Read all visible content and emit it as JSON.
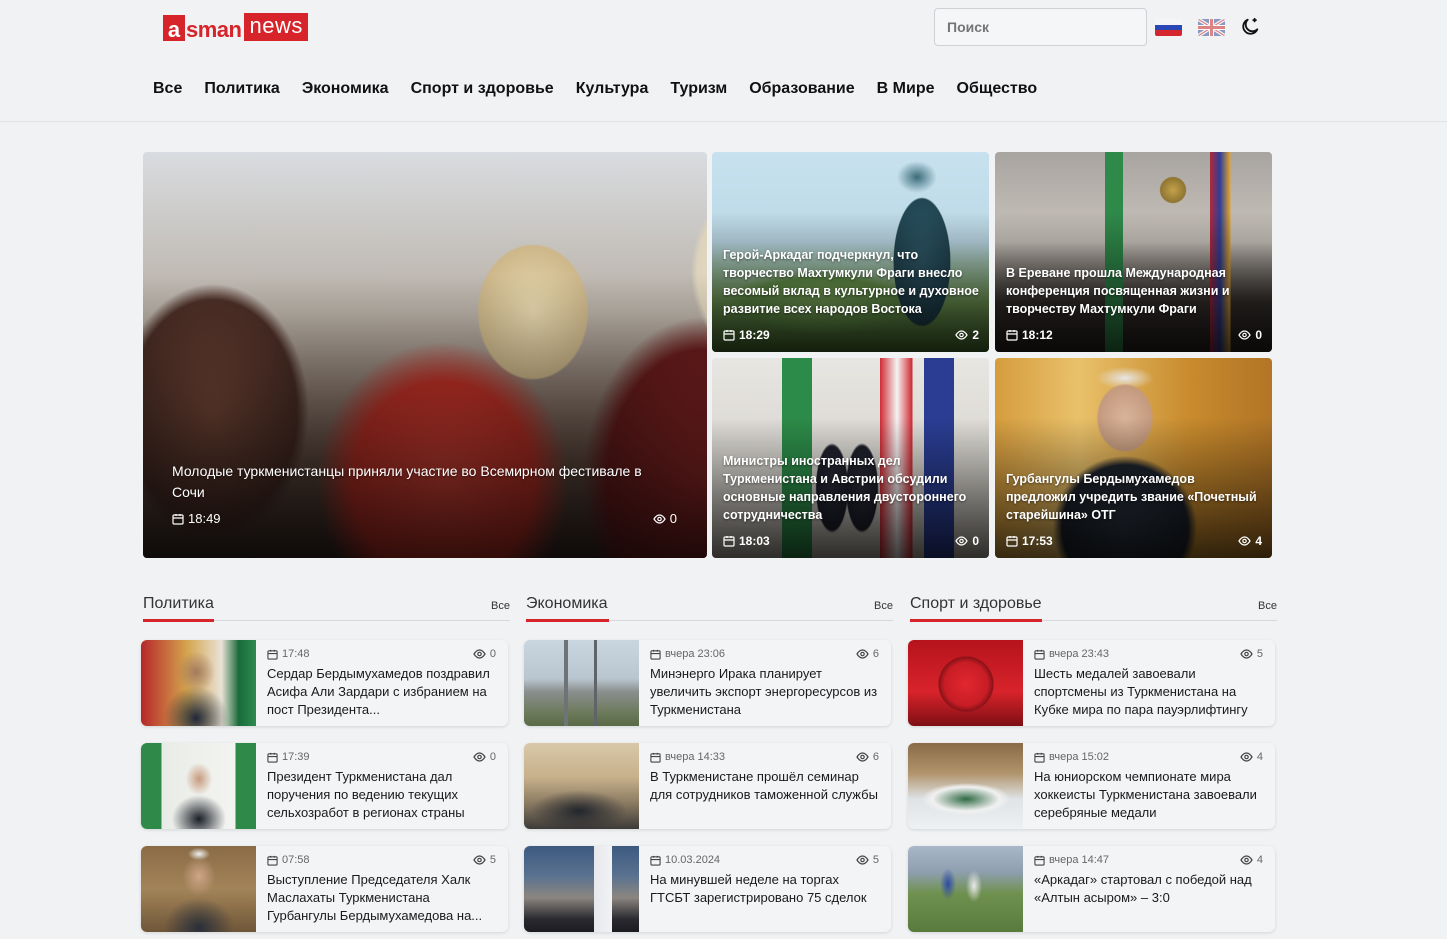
{
  "logo": {
    "a": "a",
    "sman": "sman",
    "news": "news"
  },
  "search": {
    "placeholder": "Поиск"
  },
  "nav": [
    "Все",
    "Политика",
    "Экономика",
    "Спорт и здоровье",
    "Культура",
    "Туризм",
    "Образование",
    "В Мире",
    "Общество"
  ],
  "hero": {
    "title": "Молодые туркменистанцы приняли участие во Всемирном фестивале в Сочи",
    "time": "18:49",
    "views": "0"
  },
  "tiles": [
    {
      "title": "Герой-Аркадаг подчеркнул, что творчество Махтумкули Фраги внесло весомый вклад в культурное и духовное развитие всех народов Востока",
      "time": "18:29",
      "views": "2"
    },
    {
      "title": "В Ереване прошла Международная конференция посвященная жизни и творчеству Махтумкули Фраги",
      "time": "18:12",
      "views": "0"
    },
    {
      "title": "Министры иностранных дел Туркменистана и Австрии обсудили основные направления двустороннего сотрудничества",
      "time": "18:03",
      "views": "0"
    },
    {
      "title": "Гурбангулы Бердымухамедов предложил учредить звание «Почетный старейшина» ОТГ",
      "time": "17:53",
      "views": "4"
    }
  ],
  "sections": [
    {
      "title": "Политика",
      "all": "Все",
      "items": [
        {
          "time": "17:48",
          "views": "0",
          "title": "Сердар Бердымухамедов поздравил Асифа Али Зардари с избранием на пост Президента..."
        },
        {
          "time": "17:39",
          "views": "0",
          "title": "Президент Туркменистана дал поручения по ведению текущих сельхозработ в регионах страны"
        },
        {
          "time": "07:58",
          "views": "5",
          "title": "Выступление Председателя Халк Маслахаты Туркменистана Гурбангулы Бердымухамедова на..."
        }
      ]
    },
    {
      "title": "Экономика",
      "all": "Все",
      "items": [
        {
          "time": "вчера 23:06",
          "views": "6",
          "title": "Минэнерго Ирака планирует увеличить экспорт энергоресурсов из Туркменистана"
        },
        {
          "time": "вчера 14:33",
          "views": "6",
          "title": "В Туркменистане прошёл семинар для сотрудников таможенной службы"
        },
        {
          "time": "10.03.2024",
          "views": "5",
          "title": "На минувшей неделе на торгах ГТСБТ зарегистрировано 75 сделок"
        }
      ]
    },
    {
      "title": "Спорт и здоровье",
      "all": "Все",
      "items": [
        {
          "time": "вчера 23:43",
          "views": "5",
          "title": "Шесть медалей завоевали спортсмены из Туркменистана на Кубке мира по пара пауэрлифтингу"
        },
        {
          "time": "вчера 15:02",
          "views": "4",
          "title": "На юниорском чемпионате мира хоккеисты Туркменистана завоевали серебряные медали"
        },
        {
          "time": "вчера 14:47",
          "views": "4",
          "title": "«Аркадаг» стартовал с победой над «Алтын асыром» – 3:0"
        }
      ]
    }
  ]
}
